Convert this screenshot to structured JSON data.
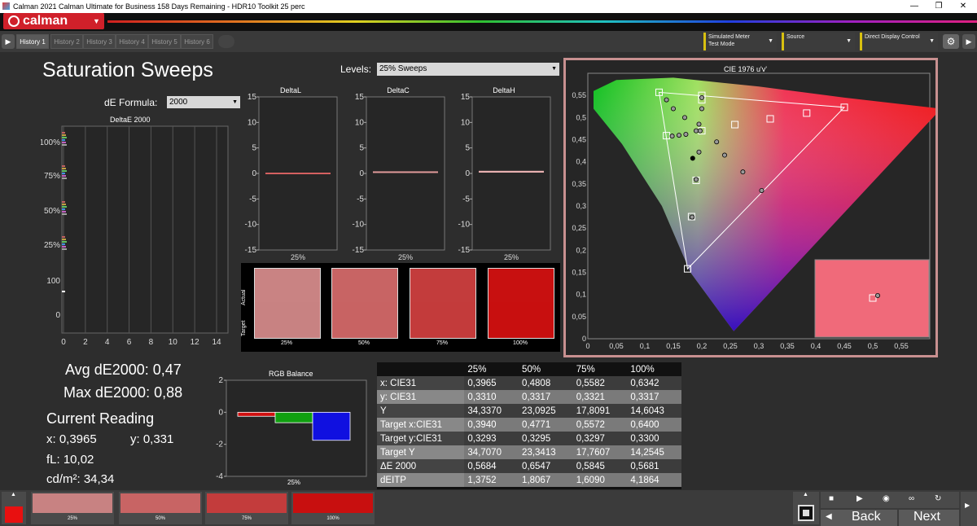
{
  "window": {
    "title": "Calman 2021 Calman Ultimate for Business 158 Days Remaining  - HDR10 Toolkit 25 perc"
  },
  "app": {
    "logo": "calman",
    "accent": "#d0202a"
  },
  "tabs": [
    "History 1",
    "History 2",
    "History 3",
    "History 4",
    "History 5",
    "History 6"
  ],
  "toolbar": {
    "simulated_meter": "Simulated Meter",
    "test_mode": "Test Mode",
    "source": "Source",
    "direct_display": "Direct Display Control"
  },
  "page": {
    "title": "Saturation Sweeps"
  },
  "levels": {
    "label": "Levels:",
    "value": "25% Sweeps"
  },
  "de_formula": {
    "label": "dE Formula:",
    "value": "2000"
  },
  "deltaE_chart": {
    "title": "DeltaE 2000",
    "y_ticks": [
      "100%",
      "75%",
      "50%",
      "25%",
      "100",
      "0"
    ],
    "x_ticks": [
      "0",
      "2",
      "4",
      "6",
      "8",
      "10",
      "12",
      "14"
    ]
  },
  "delta_charts": {
    "y_ticks": [
      "15",
      "10",
      "5",
      "0",
      "-5",
      "-10",
      "-15"
    ],
    "items": [
      {
        "title": "DeltaL",
        "xlabel": "25%",
        "value": -0.15,
        "color": "#d46060"
      },
      {
        "title": "DeltaC",
        "xlabel": "25%",
        "value": 0.25,
        "color": "#e09a9a"
      },
      {
        "title": "DeltaH",
        "xlabel": "25%",
        "value": 0.35,
        "color": "#e8b0b0"
      }
    ]
  },
  "swatches": {
    "actual_label": "Actual",
    "target_label": "Target",
    "items": [
      {
        "label": "25%",
        "actual": "#c98383",
        "target": "#c88282"
      },
      {
        "label": "50%",
        "actual": "#c86464",
        "target": "#c86363"
      },
      {
        "label": "75%",
        "actual": "#c33c3c",
        "target": "#c33b3b"
      },
      {
        "label": "100%",
        "actual": "#c81010",
        "target": "#c80f0f"
      }
    ]
  },
  "stats": {
    "avg": "Avg dE2000: 0,47",
    "max": "Max dE2000: 0,88",
    "current_title": "Current Reading",
    "x": "x: 0,3965",
    "y": "y: 0,331",
    "fl": "fL: 10,02",
    "cdm": "cd/m²: 34,34"
  },
  "rgb_balance": {
    "title": "RGB Balance",
    "xlabel": "25%",
    "y_ticks": [
      "2",
      "0",
      "-2",
      "-4"
    ],
    "ylim": [
      -4,
      2
    ],
    "bars": [
      {
        "name": "R",
        "value": -0.25,
        "color": "#d01010"
      },
      {
        "name": "G",
        "value": -0.65,
        "color": "#10a010"
      },
      {
        "name": "B",
        "value": -1.75,
        "color": "#1010e0"
      }
    ]
  },
  "cie": {
    "title": "CIE 1976 u'v'",
    "x_ticks": [
      "0",
      "0,05",
      "0,1",
      "0,15",
      "0,2",
      "0,25",
      "0,3",
      "0,35",
      "0,4",
      "0,45",
      "0,5",
      "0,55"
    ],
    "y_ticks": [
      "0,55",
      "0,5",
      "0,45",
      "0,4",
      "0,35",
      "0,3",
      "0,25",
      "0,2",
      "0,15",
      "0,1",
      "0,05",
      "0"
    ]
  },
  "table": {
    "header": [
      "",
      "25%",
      "50%",
      "75%",
      "100%"
    ],
    "rows": [
      [
        "x: CIE31",
        "0,3965",
        "0,4808",
        "0,5582",
        "0,6342"
      ],
      [
        "y: CIE31",
        "0,3310",
        "0,3317",
        "0,3321",
        "0,3317"
      ],
      [
        "Y",
        "34,3370",
        "23,0925",
        "17,8091",
        "14,6043"
      ],
      [
        "Target x:CIE31",
        "0,3940",
        "0,4771",
        "0,5572",
        "0,6400"
      ],
      [
        "Target y:CIE31",
        "0,3293",
        "0,3295",
        "0,3297",
        "0,3300"
      ],
      [
        "Target Y",
        "34,7070",
        "23,3413",
        "17,7607",
        "14,2545"
      ],
      [
        "ΔE 2000",
        "0,5684",
        "0,6547",
        "0,5845",
        "0,5681"
      ],
      [
        "dEITP",
        "1,3752",
        "1,8067",
        "1,6090",
        "4,1864"
      ]
    ]
  },
  "bottom": {
    "current_color": "#e81010",
    "swatches": [
      {
        "label": "25%",
        "color": "#c88282"
      },
      {
        "label": "50%",
        "color": "#c86464"
      },
      {
        "label": "75%",
        "color": "#c33c3c"
      },
      {
        "label": "100%",
        "color": "#c80f0f"
      }
    ],
    "back": "Back",
    "next": "Next"
  }
}
